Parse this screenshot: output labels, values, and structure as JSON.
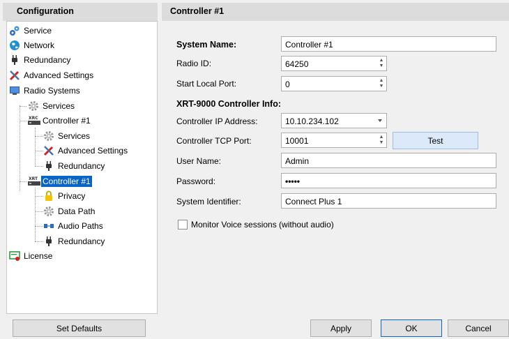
{
  "left_panel": {
    "title": "Configuration"
  },
  "right_panel": {
    "title": "Controller #1"
  },
  "tree": {
    "service": "Service",
    "network": "Network",
    "redundancy": "Redundancy",
    "advanced_settings": "Advanced Settings",
    "radio_systems": "Radio Systems",
    "services_1": "Services",
    "controller_1": "Controller #1",
    "controller_1_services": "Services",
    "controller_1_advanced": "Advanced Settings",
    "controller_1_redundancy": "Redundancy",
    "controller_2": "Controller #1",
    "privacy": "Privacy",
    "data_path": "Data Path",
    "audio_paths": "Audio Paths",
    "controller_2_redundancy": "Redundancy",
    "license": "License"
  },
  "form": {
    "system_name_label": "System Name:",
    "system_name_value": "Controller #1",
    "radio_id_label": "Radio ID:",
    "radio_id_value": "64250",
    "start_local_port_label": "Start Local Port:",
    "start_local_port_value": "0",
    "section_title": "XRT-9000 Controller Info:",
    "controller_ip_label": "Controller IP Address:",
    "controller_ip_value": "10.10.234.102",
    "controller_tcp_port_label": "Controller TCP Port:",
    "controller_tcp_port_value": "10001",
    "test_button": "Test",
    "user_name_label": "User Name:",
    "user_name_value": "Admin",
    "password_label": "Password:",
    "password_value": "•••••",
    "system_identifier_label": "System Identifier:",
    "system_identifier_value": "Connect Plus 1",
    "monitor_voice_label": "Monitor Voice sessions (without audio)",
    "monitor_voice_checked": false
  },
  "buttons": {
    "set_defaults": "Set Defaults",
    "apply": "Apply",
    "ok": "OK",
    "cancel": "Cancel"
  },
  "colors": {
    "selection": "#0a64c8",
    "header_bg": "#dcdcdc",
    "test_button_bg": "#dbe9f8"
  },
  "icons": {
    "service": "gears-icon",
    "network": "globe-icon",
    "redundancy": "plug-icon",
    "advanced_settings": "tools-icon",
    "radio_systems": "monitor-icon",
    "services": "gear-icon",
    "controller": "xrt-controller-icon",
    "privacy": "lock-icon",
    "data_path": "gear-icon",
    "audio_paths": "audio-path-icon",
    "license": "license-icon"
  }
}
